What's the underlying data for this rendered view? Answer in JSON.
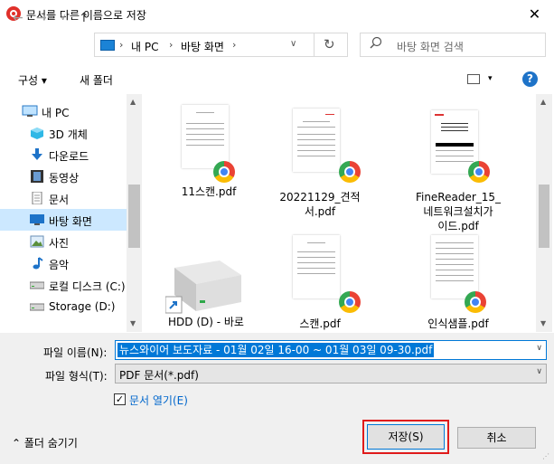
{
  "window": {
    "title": "문서를 다른 이름으로 저장",
    "close": "✕"
  },
  "nav": {
    "back": "←",
    "forward": "→",
    "recent": "∨",
    "up": "↑",
    "breadcrumb": [
      "내 PC",
      "바탕 화면"
    ],
    "sep": "›",
    "refresh": "↻",
    "dropdown": "∨",
    "search_placeholder": "바탕 화면 검색"
  },
  "toolbar": {
    "organize": "구성 ▾",
    "new_folder": "새 폴더",
    "help": "?"
  },
  "sidebar": {
    "items": [
      {
        "label": "내 PC",
        "icon": "pc-icon"
      },
      {
        "label": "3D 개체",
        "icon": "cube-icon"
      },
      {
        "label": "다운로드",
        "icon": "download-icon"
      },
      {
        "label": "동영상",
        "icon": "video-icon"
      },
      {
        "label": "문서",
        "icon": "document-icon"
      },
      {
        "label": "바탕 화면",
        "icon": "desktop-icon",
        "selected": true
      },
      {
        "label": "사진",
        "icon": "picture-icon"
      },
      {
        "label": "음악",
        "icon": "music-icon"
      },
      {
        "label": "로컬 디스크 (C:)",
        "icon": "drive-icon"
      },
      {
        "label": "Storage (D:)",
        "icon": "drive-icon"
      }
    ]
  },
  "files": [
    {
      "name": "11스캔.pdf"
    },
    {
      "name": "20221129_견적\n서.pdf"
    },
    {
      "name": "FineReader_15_\n네트워크설치가\n이드.pdf"
    },
    {
      "name": "HDD (D) - 바로"
    },
    {
      "name": "스캔.pdf"
    },
    {
      "name": "인식샘플.pdf"
    }
  ],
  "form": {
    "filename_label": "파일 이름(N):",
    "filename_value": "뉴스와이어 보도자료 - 01월 02일 16-00 ~ 01월 03일 09-30.pdf",
    "filetype_label": "파일 형식(T):",
    "filetype_value": "PDF 문서(*.pdf)",
    "open_doc_label": "문서 열기(E)",
    "open_doc_checked": true,
    "hide_folders": "⌃  폴더 숨기기",
    "save": "저장(S)",
    "cancel": "취소"
  },
  "colors": {
    "accent": "#0078d7",
    "highlight": "#e01b1b",
    "selected_bg": "#cce8ff"
  }
}
